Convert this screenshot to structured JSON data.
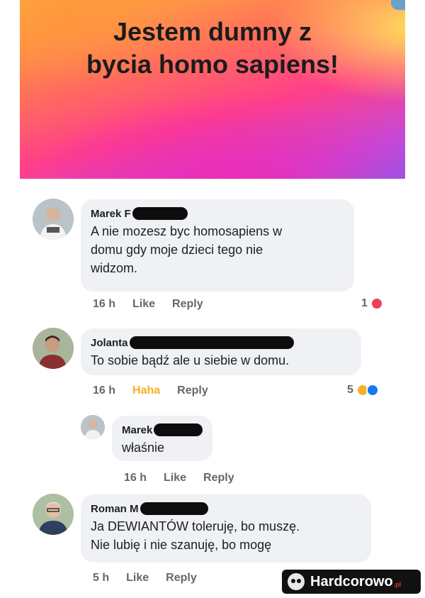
{
  "banner": {
    "title": "Jestem dumny z\nbycia homo sapiens!"
  },
  "comments": [
    {
      "author": "Marek F",
      "text": "A nie mozesz byc homosapiens w\ndomu gdy moje dzieci tego nie\nwidzom.",
      "time": "16 h",
      "action": "Like",
      "reply": "Reply",
      "reaction_count": "1",
      "reactions": [
        "love-icon"
      ]
    },
    {
      "author": "Jolanta",
      "text": "To sobie bądź ale u siebie w domu.",
      "time": "16 h",
      "action": "Haha",
      "reply": "Reply",
      "reaction_count": "5",
      "reactions": [
        "haha-icon",
        "like-icon"
      ]
    },
    {
      "author": "Marek",
      "text": "właśnie",
      "time": "16 h",
      "action": "Like",
      "reply": "Reply"
    },
    {
      "author": "Roman M",
      "text": "Ja DEWIANTÓW toleruję, bo muszę.\nNie lubię i nie szanuję, bo mogę",
      "time": "5 h",
      "action": "Like",
      "reply": "Reply"
    }
  ],
  "watermark": {
    "text": "Hardcorowo",
    "suffix": ".pl"
  },
  "colors": {
    "bubble": "#eff1f4",
    "meta": "#65676b",
    "haha": "#f7b125",
    "love": "#f33e58",
    "like": "#1877f2"
  }
}
